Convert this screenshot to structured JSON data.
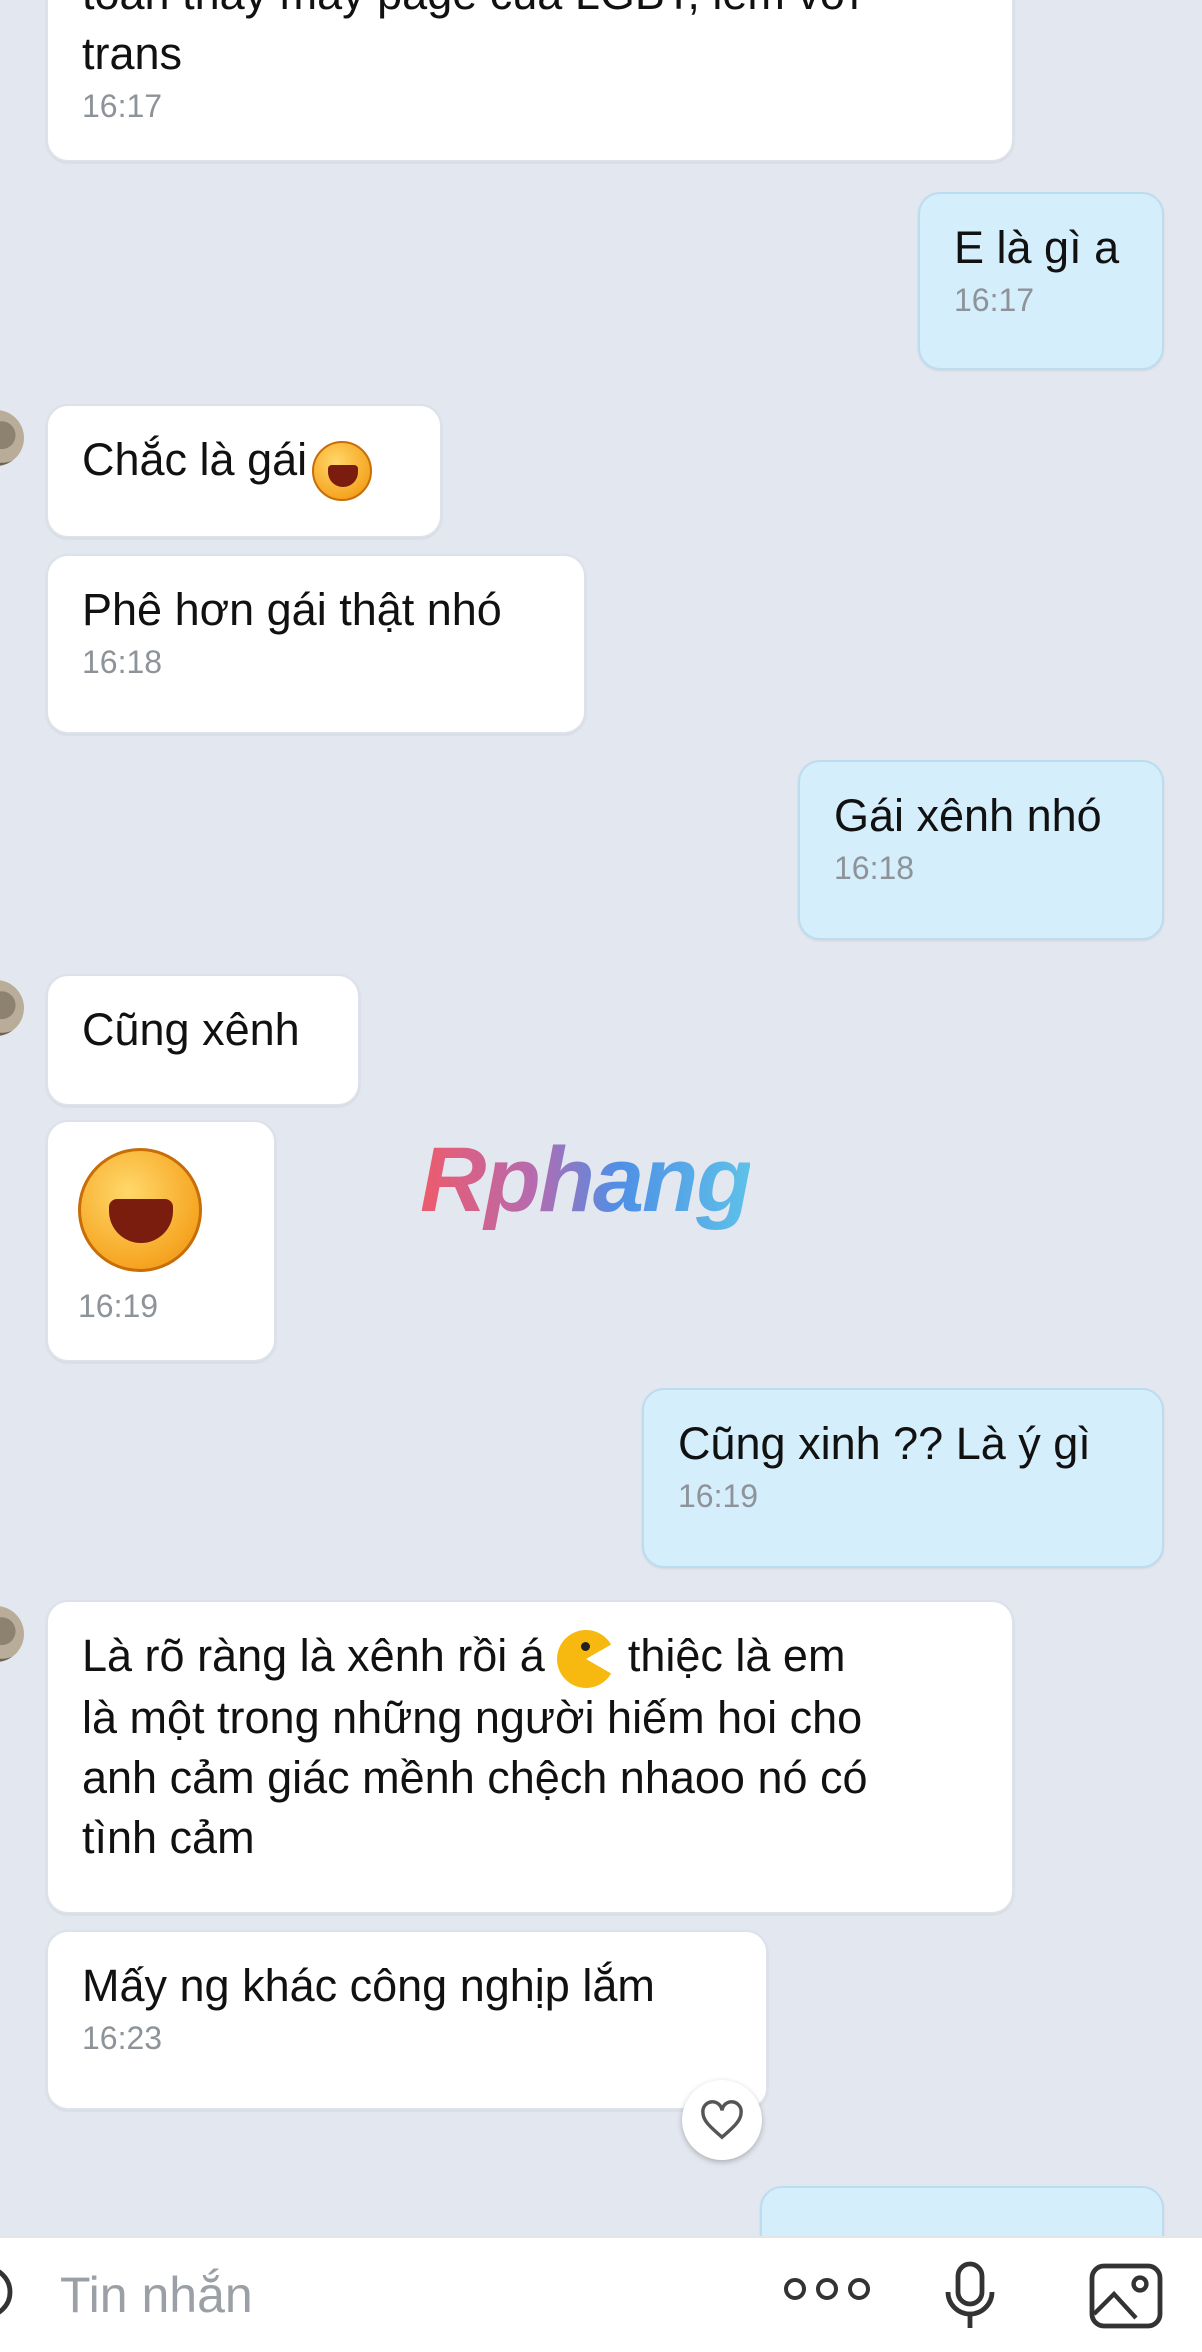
{
  "messages": [
    {
      "id": "m1",
      "side": "in",
      "text": "toàn thấy mấy page của LGBT, lem với\ntrans",
      "time": "16:17"
    },
    {
      "id": "m2",
      "side": "out",
      "text": "E là gì a",
      "time": "16:17"
    },
    {
      "id": "m3",
      "side": "in",
      "text": "Chắc là gái",
      "emoji": "laughing-face",
      "time": ""
    },
    {
      "id": "m4",
      "side": "in",
      "text": "Phê hơn gái thật nhó",
      "time": "16:18"
    },
    {
      "id": "m5",
      "side": "out",
      "text": "Gái xênh nhó",
      "time": "16:18"
    },
    {
      "id": "m6",
      "side": "in",
      "text": "Cũng xênh",
      "time": ""
    },
    {
      "id": "m7",
      "side": "in",
      "sticker": "laughing-face",
      "time": "16:19"
    },
    {
      "id": "m8",
      "side": "out",
      "text": "Cũng xinh ?? Là ý gì",
      "time": "16:19"
    },
    {
      "id": "m9",
      "side": "in",
      "text_a": "Là rõ ràng là xênh rồi á",
      "emoji": "pacman",
      "text_b": "thiệc là em\nlà một trong những người hiếm hoi cho\nanh cảm giác mềnh chệch nhaoo nó có\ntình cảm",
      "time": ""
    },
    {
      "id": "m10",
      "side": "in",
      "text": "Mấy ng khác công nghịp lắm",
      "time": "16:23"
    }
  ],
  "watermark": "Rphang",
  "composer": {
    "placeholder": "Tin nhắn"
  },
  "icons": {
    "reaction": "heart-icon",
    "more": "more-icon",
    "mic": "mic-icon",
    "image": "image-icon",
    "emoji": "emoji-icon"
  },
  "colors": {
    "background": "#e3e7ef",
    "incoming_bubble": "#ffffff",
    "outgoing_bubble": "#d4eefb",
    "timestamp": "#8e9399"
  }
}
